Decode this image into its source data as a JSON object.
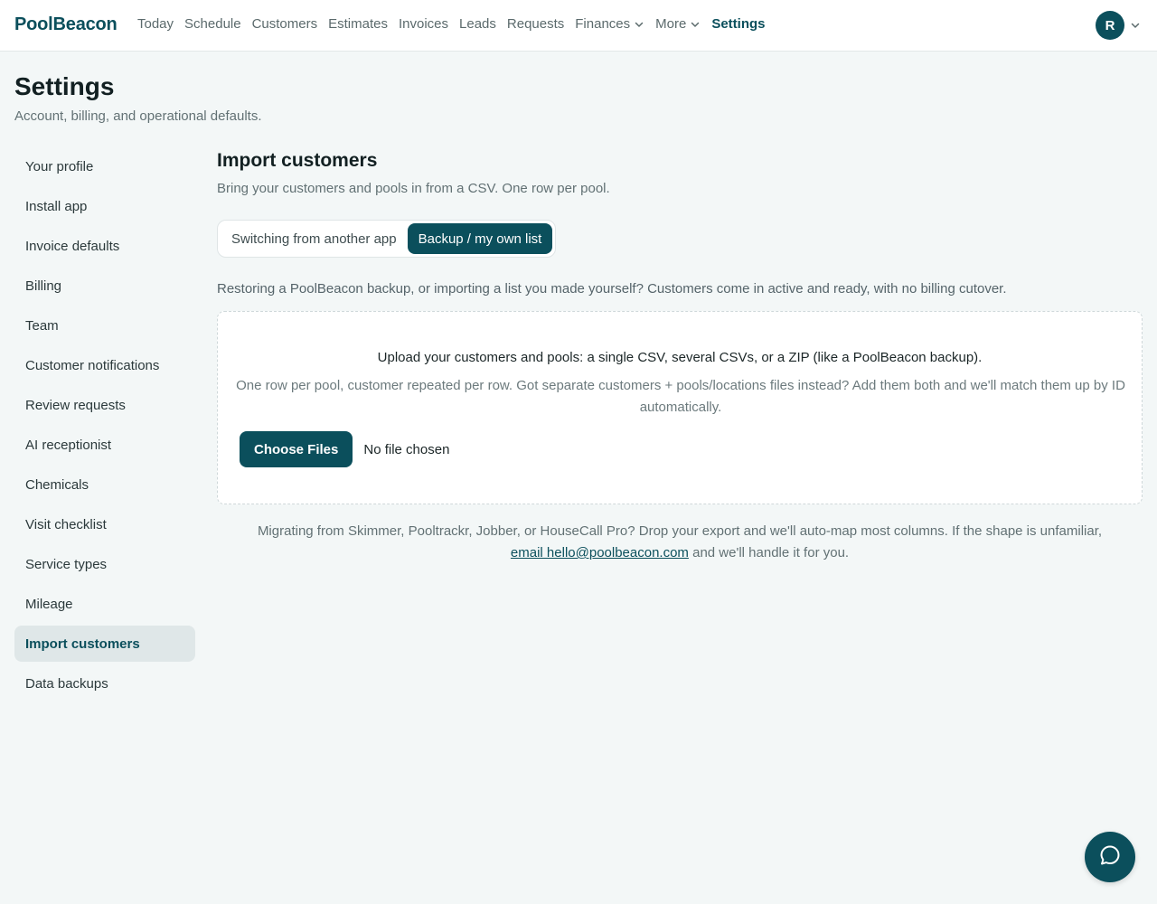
{
  "app": {
    "brand": "PoolBeacon"
  },
  "nav": {
    "items": [
      {
        "label": "Today"
      },
      {
        "label": "Schedule"
      },
      {
        "label": "Customers"
      },
      {
        "label": "Estimates"
      },
      {
        "label": "Invoices"
      },
      {
        "label": "Leads"
      },
      {
        "label": "Requests"
      },
      {
        "label": "Finances",
        "icon": "chevron-down-icon"
      },
      {
        "label": "More",
        "icon": "chevron-down-icon"
      },
      {
        "label": "Settings",
        "active": true
      }
    ]
  },
  "user": {
    "initial": "R",
    "icon": "chevron-down-icon"
  },
  "page": {
    "title": "Settings",
    "subtitle": "Account, billing, and operational defaults."
  },
  "sidebar": {
    "items": [
      {
        "label": "Your profile"
      },
      {
        "label": "Install app"
      },
      {
        "label": "Invoice defaults"
      },
      {
        "label": "Billing"
      },
      {
        "label": "Team"
      },
      {
        "label": "Customer notifications"
      },
      {
        "label": "Review requests"
      },
      {
        "label": "AI receptionist"
      },
      {
        "label": "Chemicals"
      },
      {
        "label": "Visit checklist"
      },
      {
        "label": "Service types"
      },
      {
        "label": "Mileage"
      },
      {
        "label": "Import customers",
        "active": true
      },
      {
        "label": "Data backups"
      }
    ]
  },
  "import": {
    "title": "Import customers",
    "description": "Bring your customers and pools in from a CSV. One row per pool.",
    "modes": [
      {
        "label": "Switching from another app"
      },
      {
        "label": "Backup / my own list",
        "active": true
      }
    ],
    "mode_description": "Restoring a PoolBeacon backup, or importing a list you made yourself? Customers come in active and ready, with no billing cutover.",
    "dropzone": {
      "title": "Upload your customers and pools: a single CSV, several CSVs, or a ZIP (like a PoolBeacon backup).",
      "body": "One row per pool, customer repeated per row. Got separate customers + pools/locations files instead? Add them both and we'll match them up by ID automatically.",
      "button_label": "Choose Files",
      "file_status": "No file chosen"
    },
    "migrate_note": {
      "text": "Migrating from Skimmer, Pooltrackr, Jobber, or HouseCall Pro? Drop your export and we'll auto-map most columns. If the shape is unfamiliar,",
      "link": "email hello@poolbeacon.com",
      "suffix": "and we'll handle it for you."
    }
  },
  "chat": {
    "icon": "chat-bubble-icon"
  },
  "colors": {
    "brand": "#0b4f5c",
    "background": "#f3f7f7",
    "active_sidebar_bg": "#dfe7e8"
  }
}
